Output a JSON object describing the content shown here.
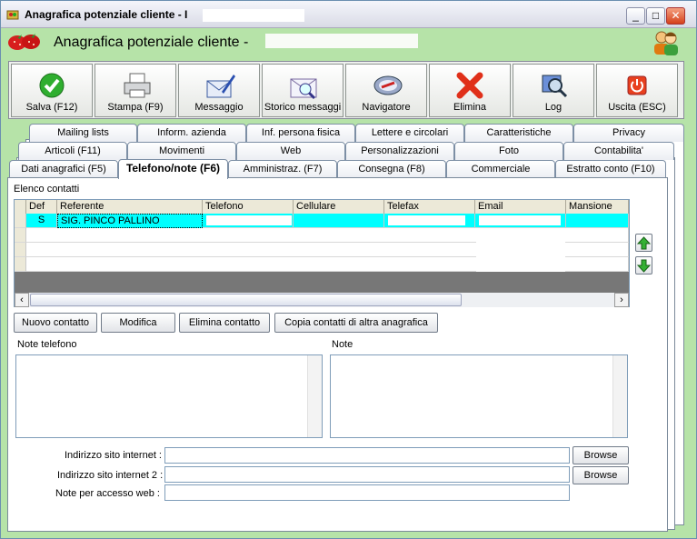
{
  "window": {
    "title": "Anagrafica potenziale cliente - I",
    "minimize": "_",
    "maximize": "□",
    "close": "✕"
  },
  "header": {
    "title": "Anagrafica potenziale cliente -"
  },
  "toolbar": [
    {
      "label": "Salva (F12)",
      "icon": "check-icon"
    },
    {
      "label": "Stampa (F9)",
      "icon": "printer-icon"
    },
    {
      "label": "Messaggio",
      "icon": "envelope-pen-icon"
    },
    {
      "label": "Storico messaggi",
      "icon": "envelope-search-icon"
    },
    {
      "label": "Navigatore",
      "icon": "compass-icon"
    },
    {
      "label": "Elimina",
      "icon": "x-icon"
    },
    {
      "label": "Log",
      "icon": "log-search-icon"
    },
    {
      "label": "Uscita (ESC)",
      "icon": "power-icon"
    }
  ],
  "tabs": {
    "row1": [
      "Mailing lists",
      "Inform. azienda",
      "Inf. persona fisica",
      "Lettere e circolari",
      "Caratteristiche",
      "Privacy"
    ],
    "row2": [
      "Articoli (F11)",
      "Movimenti",
      "Web",
      "Personalizzazioni",
      "Foto",
      "Contabilita'"
    ],
    "row3": [
      "Dati anagrafici (F5)",
      "Telefono/note (F6)",
      "Amministraz. (F7)",
      "Consegna (F8)",
      "Commerciale",
      "Estratto conto (F10)"
    ]
  },
  "contacts": {
    "section_label": "Elenco contatti",
    "columns": [
      "Def",
      "Referente",
      "Telefono",
      "Cellulare",
      "Telefax",
      "Email",
      "Mansione"
    ],
    "rows": [
      [
        "S",
        "SIG. PINCO PALLINO",
        "",
        "",
        "",
        "",
        ""
      ]
    ]
  },
  "buttons": {
    "new": "Nuovo contatto",
    "edit": "Modifica",
    "delete": "Elimina contatto",
    "copy": "Copia contatti di altra anagrafica"
  },
  "notes": {
    "phone_label": "Note telefono",
    "notes_label": "Note"
  },
  "web": {
    "site_label": "Indirizzo sito internet :",
    "site_value": "",
    "site2_label": "Indirizzo sito internet 2 :",
    "site2_value": "",
    "access_label": "Note per accesso web :",
    "access_value": "",
    "browse": "Browse"
  },
  "colors": {
    "accent_green": "#b6e3a8",
    "selected_row": "#00ffff"
  }
}
